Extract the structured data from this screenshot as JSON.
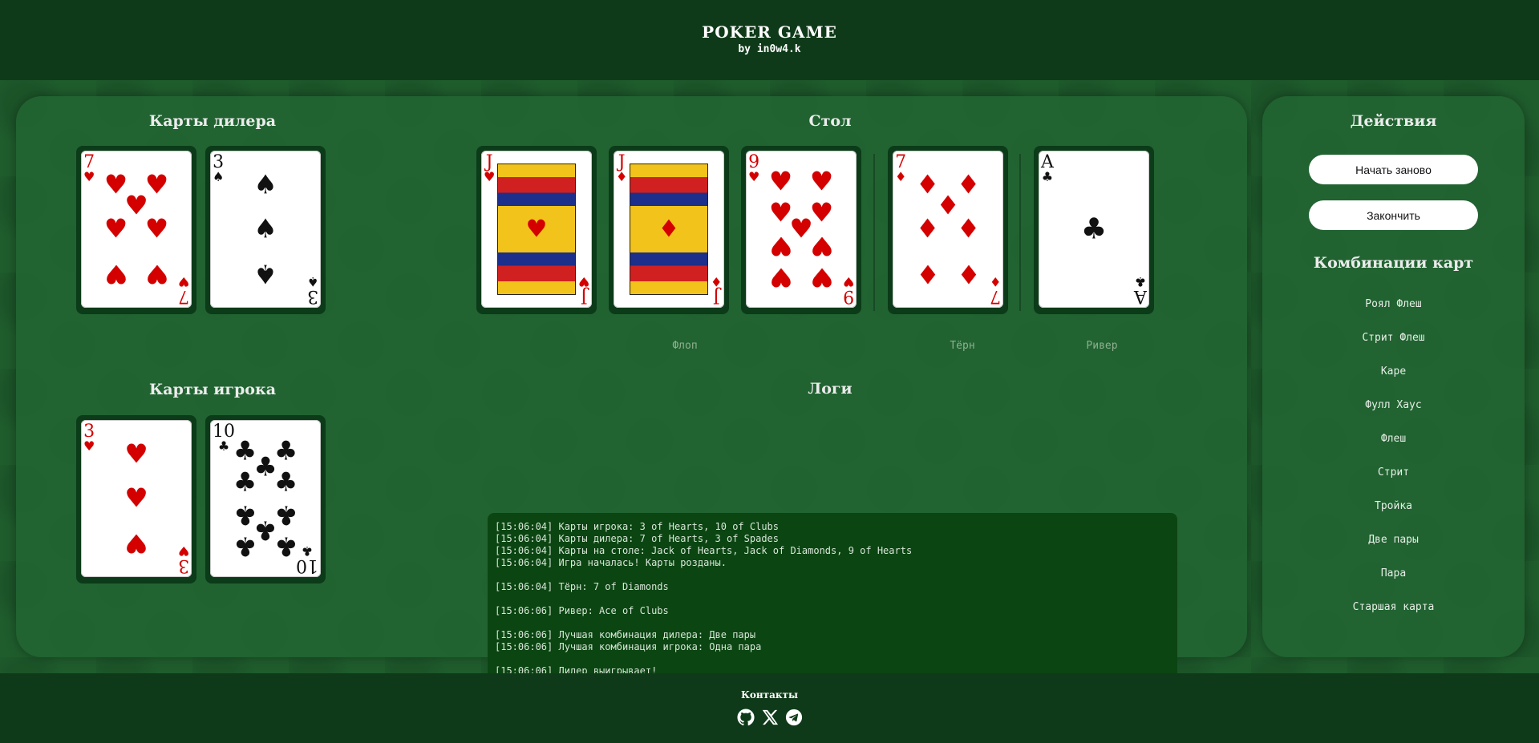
{
  "header": {
    "title": "POKER GAME",
    "subtitle": "by in0w4.k"
  },
  "dealer": {
    "title": "Карты дилера",
    "cards": [
      {
        "rank": "7",
        "suit": "♥",
        "color": "red"
      },
      {
        "rank": "3",
        "suit": "♠",
        "color": "black"
      }
    ]
  },
  "player": {
    "title": "Карты игрока",
    "cards": [
      {
        "rank": "3",
        "suit": "♥",
        "color": "red"
      },
      {
        "rank": "10",
        "suit": "♣",
        "color": "black"
      }
    ]
  },
  "table": {
    "title": "Стол",
    "cards": [
      {
        "rank": "J",
        "suit": "♥",
        "color": "red"
      },
      {
        "rank": "J",
        "suit": "♦",
        "color": "red"
      },
      {
        "rank": "9",
        "suit": "♥",
        "color": "red"
      },
      {
        "rank": "7",
        "suit": "♦",
        "color": "red"
      },
      {
        "rank": "A",
        "suit": "♣",
        "color": "black"
      }
    ],
    "stage_labels": {
      "flop": "Флоп",
      "turn": "Тёрн",
      "river": "Ривер"
    }
  },
  "logs": {
    "title": "Логи",
    "lines": [
      "[15:06:04] Карты игрока: 3 of Hearts, 10 of Clubs",
      "[15:06:04] Карты дилера: 7 of Hearts, 3 of Spades",
      "[15:06:04] Карты на столе: Jack of Hearts, Jack of Diamonds, 9 of Hearts",
      "[15:06:04] Игра началась! Карты розданы.",
      "",
      "[15:06:04] Тёрн: 7 of Diamonds",
      "",
      "[15:06:06] Ривер: Ace of Clubs",
      "",
      "[15:06:06] Лучшая комбинация дилера: Две пары",
      "[15:06:06] Лучшая комбинация игрока: Одна пара",
      "",
      "[15:06:06] Дилер выигрывает!"
    ]
  },
  "actions": {
    "title": "Действия",
    "restart_label": "Начать заново",
    "finish_label": "Закончить"
  },
  "combinations": {
    "title": "Комбинации карт",
    "items": [
      "Роял Флеш",
      "Стрит Флеш",
      "Каре",
      "Фулл Хаус",
      "Флеш",
      "Стрит",
      "Тройка",
      "Две пары",
      "Пара",
      "Старшая карта"
    ]
  },
  "footer": {
    "contacts_label": "Контакты",
    "icons": [
      "github-icon",
      "x-icon",
      "telegram-icon"
    ]
  },
  "colors": {
    "felt": "#1e5b2c",
    "header": "#0f3a19",
    "log_bg": "#0b4512",
    "red_suit": "#d40000"
  }
}
